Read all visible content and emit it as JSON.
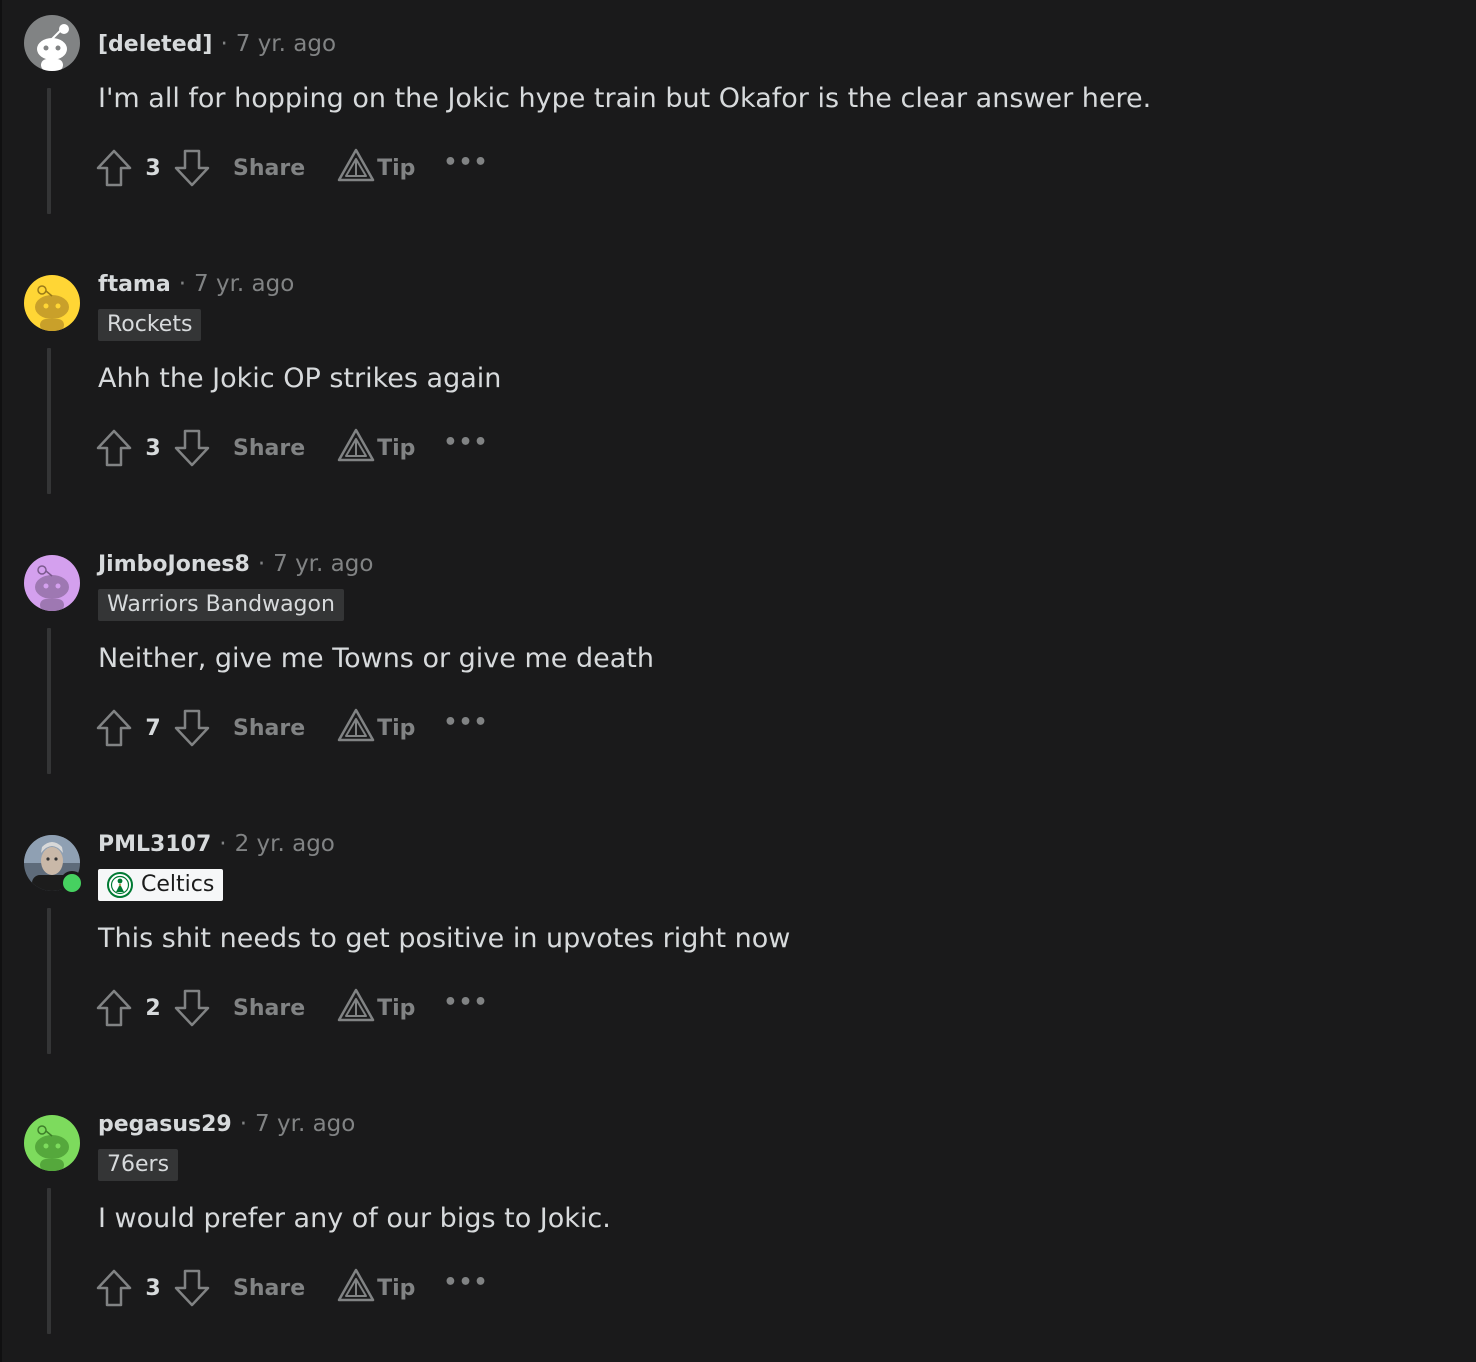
{
  "comments": [
    {
      "username": "[deleted]",
      "age": "7 yr. ago",
      "flair": null,
      "body": "I'm all for hopping on the Jokic hype train but Okafor is the clear answer here.",
      "votes": "3",
      "avatar_color": "#818384"
    },
    {
      "username": "ftama",
      "age": "7 yr. ago",
      "flair": "Rockets",
      "body": "Ahh the Jokic OP strikes again",
      "votes": "3",
      "avatar_color": "#ffd635"
    },
    {
      "username": "JimboJones8",
      "age": "7 yr. ago",
      "flair": "Warriors Bandwagon",
      "body": "Neither, give me Towns or give me death",
      "votes": "7",
      "avatar_color": "#d4a0ee"
    },
    {
      "username": "PML3107",
      "age": "2 yr. ago",
      "flair": "Celtics",
      "body": "This shit needs to get positive in upvotes right now",
      "votes": "2",
      "avatar_color": "#4a4a4a",
      "online": true
    },
    {
      "username": "pegasus29",
      "age": "7 yr. ago",
      "flair": "76ers",
      "body": "I would prefer any of our bigs to Jokic.",
      "votes": "3",
      "avatar_color": "#7ddb5d"
    }
  ],
  "labels": {
    "share": "Share",
    "tip": "Tip",
    "more": "•••",
    "separator": "·"
  },
  "icons": {
    "upvote": "arrow-up-icon",
    "downvote": "arrow-down-icon",
    "tip": "tip-triangle-icon",
    "more": "more-options-icon",
    "avatar": "snoo-avatar-icon"
  }
}
